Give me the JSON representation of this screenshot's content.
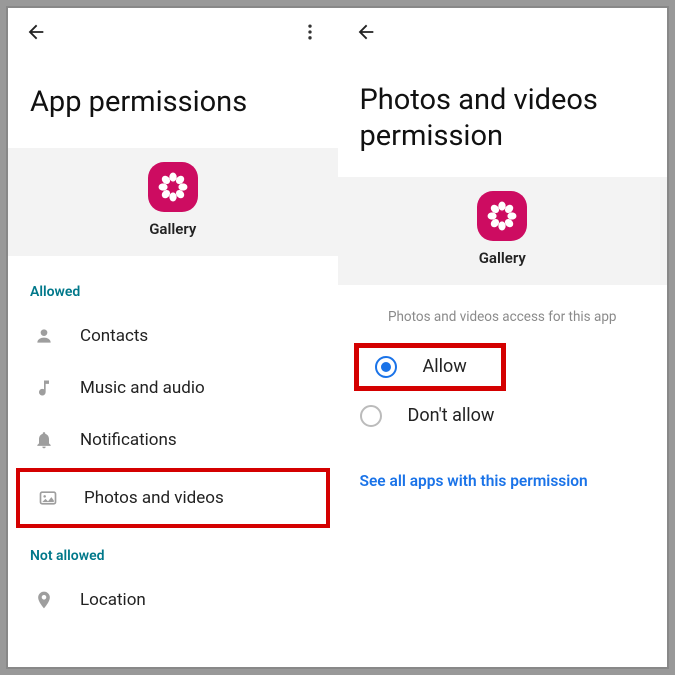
{
  "left": {
    "title": "App permissions",
    "app_name": "Gallery",
    "allowed_label": "Allowed",
    "not_allowed_label": "Not allowed",
    "perms": {
      "contacts": "Contacts",
      "music": "Music and audio",
      "notifications": "Notifications",
      "photos": "Photos and videos",
      "location": "Location"
    }
  },
  "right": {
    "title": "Photos and videos permission",
    "app_name": "Gallery",
    "subhead": "Photos and videos access for this app",
    "options": {
      "allow": "Allow",
      "dont_allow": "Don't allow"
    },
    "link": "See all apps with this permission"
  }
}
